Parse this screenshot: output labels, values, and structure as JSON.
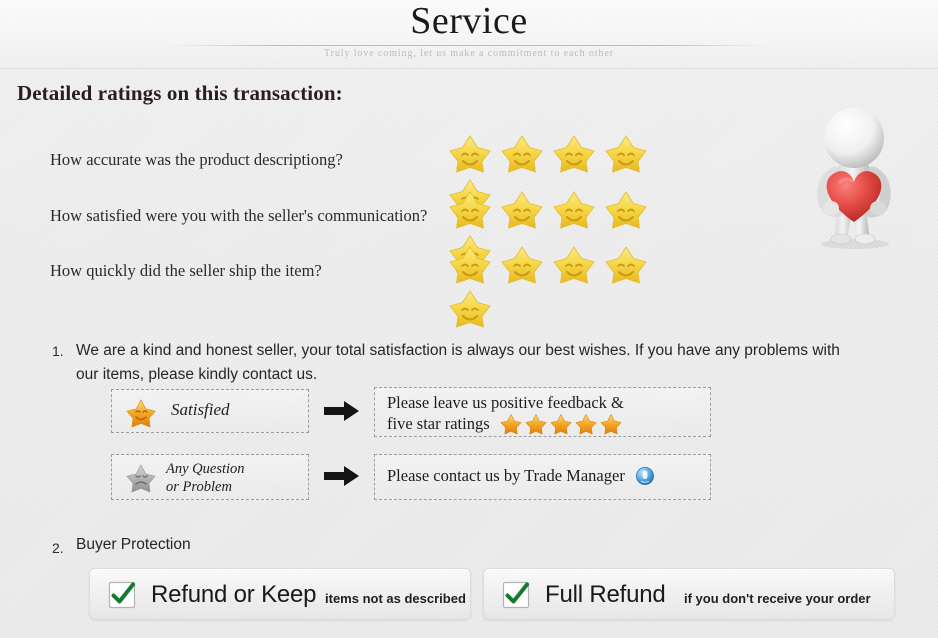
{
  "banner": {
    "title": "Service",
    "subtitle": "Truly love coming, let us make a commitment to each other"
  },
  "ratings": {
    "heading": "Detailed ratings on this transaction:",
    "rows": [
      {
        "question": "How accurate was the product descriptiong?",
        "stars": 5,
        "star_icon": "smiley-star-icon"
      },
      {
        "question": "How satisfied were you with the seller's communication?",
        "stars": 5,
        "star_icon": "smiley-star-icon"
      },
      {
        "question": "How quickly did the seller ship the item?",
        "stars": 5,
        "star_icon": "smiley-star-icon"
      }
    ],
    "mascot_icon": "figure-holding-heart-icon"
  },
  "items": [
    {
      "number": "1.",
      "text": "We are a kind and honest seller, your total satisfaction is always our best wishes. If you have any problems with our items, please kindly contact us."
    },
    {
      "number": "2.",
      "text": "Buyer Protection"
    }
  ],
  "flows": [
    {
      "source_label": "Satisfied",
      "source_icon": "happy-star-icon",
      "arrow_icon": "arrow-right-icon",
      "target_line1": "Please leave us positive feedback &",
      "target_line2": "five star ratings",
      "target_stars": 5,
      "target_star_icon": "orange-star-icon"
    },
    {
      "source_label_line1": "Any Question",
      "source_label_line2": "or Problem",
      "source_icon": "sad-star-icon",
      "arrow_icon": "arrow-right-icon",
      "target_text": "Please contact us by Trade Manager",
      "target_icon": "trade-manager-icon"
    }
  ],
  "protection": [
    {
      "check_icon": "green-check-icon",
      "title": "Refund or Keep",
      "subtitle": "items not as described"
    },
    {
      "check_icon": "green-check-icon",
      "title": "Full Refund",
      "subtitle": "if you don't receive your order"
    }
  ],
  "colors": {
    "star_yellow": "#f5d142",
    "star_orange": "#f0921e",
    "heart_red": "#e0403a",
    "check_green": "#16782f",
    "trade_manager_blue": "#3a93d6",
    "text_dark": "#262626",
    "background": "#eeeeee"
  }
}
